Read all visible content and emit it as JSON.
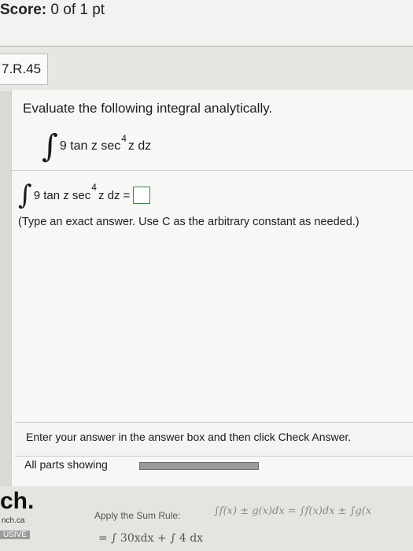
{
  "header": {
    "score_label": "Score:",
    "score_value": "0 of 1 pt"
  },
  "question": {
    "id": "7.R.45",
    "prompt": "Evaluate the following integral analytically.",
    "integral_sign": "∫",
    "integrand_base": "9 tan z sec",
    "integrand_exponent": "4",
    "integrand_tail": "z dz",
    "equals": "=",
    "hint": "(Type an exact answer. Use C as the arbitrary constant as needed.)"
  },
  "instructions": "Enter your answer in the answer box and then click Check Answer.",
  "parts": {
    "label": "All parts showing"
  },
  "promo": {
    "logo": "ch.",
    "site": "nch.ca",
    "exclusive": "USIVE",
    "sum_rule_label": "Apply the Sum Rule:",
    "sum_rule_formula": "∫f(x) ± g(x)dx = ∫f(x)dx ± ∫g(x",
    "expression": "= ∫ 30xdx + ∫ 4 dx"
  }
}
